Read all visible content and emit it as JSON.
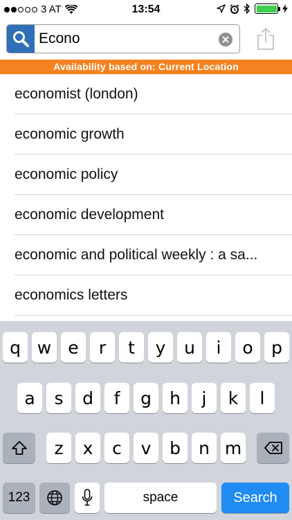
{
  "status_bar": {
    "carrier": "3 AT",
    "time": "13:54"
  },
  "search": {
    "value": "Econo",
    "search_icon": "search-icon",
    "clear_icon": "clear-icon",
    "share_icon": "share-icon"
  },
  "banner": {
    "text": "Availability based on: Current Location",
    "color": "#f58220"
  },
  "suggestions": [
    "economist (london)",
    "economic growth",
    "economic policy",
    "economic development",
    "economic and political weekly : a sa...",
    "economics letters"
  ],
  "keyboard": {
    "row1": [
      "q",
      "w",
      "e",
      "r",
      "t",
      "y",
      "u",
      "i",
      "o",
      "p"
    ],
    "row2": [
      "a",
      "s",
      "d",
      "f",
      "g",
      "h",
      "j",
      "k",
      "l"
    ],
    "row3": [
      "z",
      "x",
      "c",
      "v",
      "b",
      "n",
      "m"
    ],
    "numbers_label": "123",
    "space_label": "space",
    "search_label": "Search",
    "accent_color": "#1f8bf3"
  }
}
